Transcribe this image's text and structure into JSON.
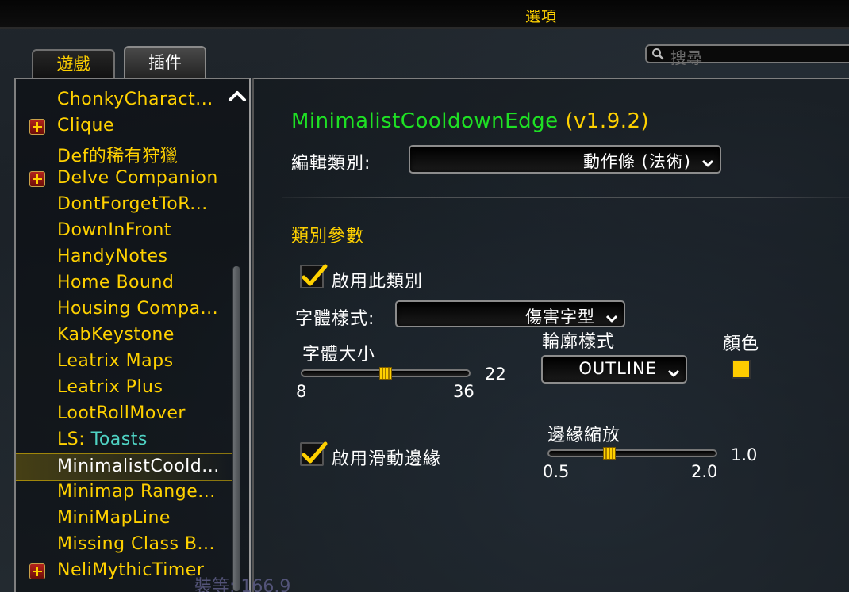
{
  "window": {
    "title": "選項"
  },
  "tabs": [
    {
      "label": "遊戲",
      "active": false
    },
    {
      "label": "插件",
      "active": true
    }
  ],
  "search": {
    "placeholder": "搜尋"
  },
  "addon_list": [
    {
      "label": "ChonkyCharact...",
      "expandable": false,
      "selected": false
    },
    {
      "label": "Clique",
      "expandable": true,
      "selected": false
    },
    {
      "label": "Def的稀有狩獵",
      "expandable": false,
      "selected": false
    },
    {
      "label": "Delve Companion",
      "expandable": true,
      "selected": false
    },
    {
      "label": "DontForgetToR...",
      "expandable": false,
      "selected": false
    },
    {
      "label": "DownInFront",
      "expandable": false,
      "selected": false
    },
    {
      "label": "HandyNotes",
      "expandable": false,
      "selected": false
    },
    {
      "label": "Home Bound",
      "expandable": false,
      "selected": false
    },
    {
      "label": "Housing Compa...",
      "expandable": false,
      "selected": false
    },
    {
      "label": "KabKeystone",
      "expandable": false,
      "selected": false
    },
    {
      "label": "Leatrix Maps",
      "expandable": false,
      "selected": false
    },
    {
      "label": "Leatrix Plus",
      "expandable": false,
      "selected": false
    },
    {
      "label": "LootRollMover",
      "expandable": false,
      "selected": false
    },
    {
      "label": "LS: ",
      "label_suffix": "Toasts",
      "expandable": false,
      "selected": false
    },
    {
      "label": "MinimalistCoold...",
      "expandable": false,
      "selected": true
    },
    {
      "label": "Minimap Range...",
      "expandable": false,
      "selected": false
    },
    {
      "label": "MiniMapLine",
      "expandable": false,
      "selected": false
    },
    {
      "label": "Missing Class B...",
      "expandable": false,
      "selected": false
    },
    {
      "label": "NeliMythicTimer",
      "expandable": true,
      "selected": false
    }
  ],
  "addon_panel": {
    "name": "MinimalistCooldownEdge",
    "version": "(v1.9.2)",
    "edit_category_label": "編輯類別:",
    "edit_category_value": "動作條 (法術)",
    "section_title": "類別參數",
    "enable_category": {
      "label": "啟用此類別",
      "checked": true
    },
    "font_style": {
      "label": "字體樣式:",
      "value": "傷害字型"
    },
    "font_size": {
      "label": "字體大小",
      "min": "8",
      "max": "36",
      "value": "22",
      "fraction": 0.5
    },
    "outline_style": {
      "label": "輪廓樣式",
      "value": "OUTLINE"
    },
    "color": {
      "label": "顏色",
      "swatch": "#ffcc00"
    },
    "enable_swipe_edge": {
      "label": "啟用滑動邊緣",
      "checked": true
    },
    "edge_scale": {
      "label": "邊緣縮放",
      "min": "0.5",
      "max": "2.0",
      "value": "1.0",
      "fraction": 0.333
    }
  },
  "bottom_ghost_text": "裝等: 166.9",
  "colors": {
    "gold": "#ffd100",
    "title_green": "#1ee024",
    "teal": "#4fd3c4"
  }
}
